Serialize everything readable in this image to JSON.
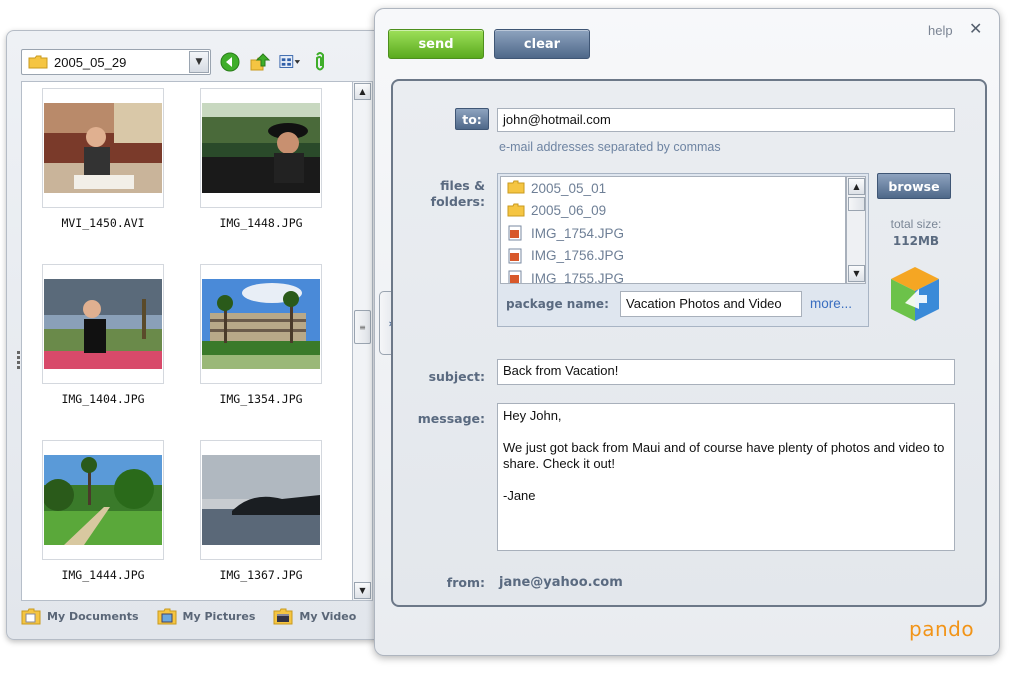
{
  "browser": {
    "folder": "2005_05_29",
    "thumbnails": [
      {
        "file": "MVI_1450.AVI"
      },
      {
        "file": "IMG_1448.JPG"
      },
      {
        "file": "IMG_1404.JPG"
      },
      {
        "file": "IMG_1354.JPG"
      },
      {
        "file": "IMG_1444.JPG"
      },
      {
        "file": "IMG_1367.JPG"
      }
    ],
    "quicklinks": {
      "documents": "My Documents",
      "pictures": "My Pictures",
      "video": "My Video"
    }
  },
  "toolbar": {
    "send_label": "send",
    "clear_label": "clear",
    "help_label": "help",
    "close_glyph": "✕"
  },
  "form": {
    "to_label": "to:",
    "to_value": "john@hotmail.com",
    "to_hint": "e-mail addresses separated by commas",
    "files_label": "files &\nfolders:",
    "files": [
      {
        "name": "2005_05_01",
        "kind": "folder"
      },
      {
        "name": "2005_06_09",
        "kind": "folder"
      },
      {
        "name": "IMG_1754.JPG",
        "kind": "image"
      },
      {
        "name": "IMG_1756.JPG",
        "kind": "image"
      },
      {
        "name": "IMG_1755.JPG",
        "kind": "image"
      }
    ],
    "package_label": "package name:",
    "package_value": "Vacation Photos and Video",
    "more_label": "more...",
    "browse_label": "browse",
    "total_size_label": "total size:",
    "total_size_value": "112MB",
    "subject_label": "subject:",
    "subject_value": "Back from Vacation!",
    "message_label": "message:",
    "message_value": "Hey John,\n\nWe just got back from Maui and of course have plenty of photos and video to share. Check it out!\n\n-Jane",
    "from_label": "from:",
    "from_value": "jane@yahoo.com"
  },
  "brand": {
    "logo_text": "pando",
    "accent": "#f29418",
    "send_color": "#5aaa1e",
    "button_color": "#4e6889"
  },
  "icons": [
    "folder-icon",
    "dropdown-arrow-icon",
    "back-arrow-icon",
    "up-folder-icon",
    "view-mode-icon",
    "attach-icon",
    "scroll-up-icon",
    "scroll-down-icon",
    "collapse-arrows-icon",
    "close-icon",
    "pando-cube-icon"
  ]
}
